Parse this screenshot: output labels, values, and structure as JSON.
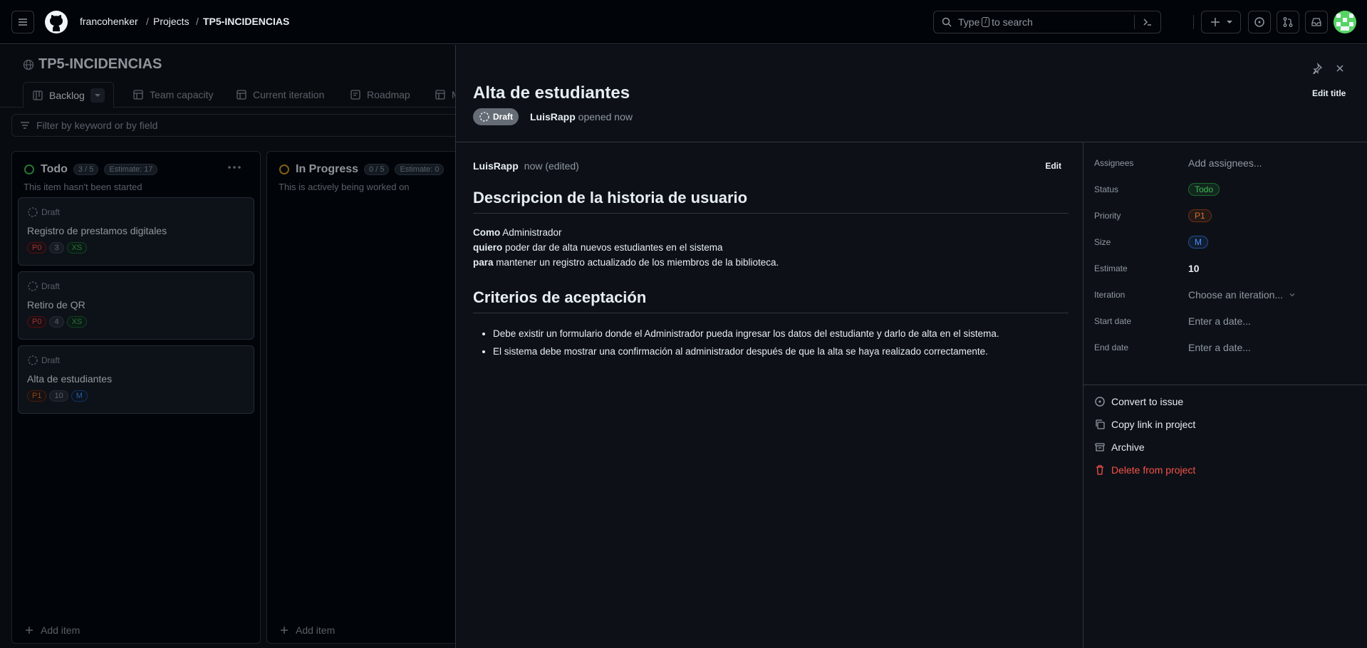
{
  "header": {
    "owner": "francohenker",
    "projects": "Projects",
    "project": "TP5-INCIDENCIAS",
    "search_pre": "Type",
    "search_key": "/",
    "search_post": "to search"
  },
  "board": {
    "title": "TP5-INCIDENCIAS",
    "tabs": [
      "Backlog",
      "Team capacity",
      "Current iteration",
      "Roadmap",
      "M"
    ],
    "filter_placeholder": "Filter by keyword or by field",
    "columns": [
      {
        "name": "Todo",
        "count": "3 / 5",
        "estimate": "Estimate: 17",
        "desc": "This item hasn't been started",
        "add": "Add item"
      },
      {
        "name": "In Progress",
        "count": "0 / 5",
        "estimate": "Estimate: 0",
        "desc": "This is actively being worked on",
        "add": "Add item"
      }
    ],
    "cards": [
      {
        "draft": "Draft",
        "title": "Registro de prestamos digitales",
        "tags": [
          "P0",
          "3",
          "XS"
        ]
      },
      {
        "draft": "Draft",
        "title": "Retiro de QR",
        "tags": [
          "P0",
          "4",
          "XS"
        ]
      },
      {
        "draft": "Draft",
        "title": "Alta de estudiantes",
        "tags": [
          "P1",
          "10",
          "M"
        ]
      }
    ]
  },
  "detail": {
    "title": "Alta de estudiantes",
    "edit_title": "Edit title",
    "badge": "Draft",
    "author": "LuisRapp",
    "opened": "opened now",
    "comment_time": "now (edited)",
    "edit": "Edit",
    "heading1": "Descripcion de la historia de usuario",
    "line1_bold": "Como",
    "line1_rest": " Administrador",
    "line2_bold": "quiero",
    "line2_rest": " poder dar de alta nuevos estudiantes en el sistema",
    "line3_bold": "para",
    "line3_rest": " mantener un registro actualizado de los miembros de la biblioteca.",
    "heading2": "Criterios de aceptación",
    "criteria": [
      "Debe existir un formulario donde el Administrador pueda ingresar los datos del estudiante y darlo de alta en el sistema.",
      "El sistema debe mostrar una confirmación al administrador después de que la alta se haya realizado correctamente."
    ]
  },
  "fields": {
    "assignees_label": "Assignees",
    "assignees_value": "Add assignees...",
    "status_label": "Status",
    "status_value": "Todo",
    "priority_label": "Priority",
    "priority_value": "P1",
    "size_label": "Size",
    "size_value": "M",
    "estimate_label": "Estimate",
    "estimate_value": "10",
    "iteration_label": "Iteration",
    "iteration_value": "Choose an iteration...",
    "start_label": "Start date",
    "start_value": "Enter a date...",
    "end_label": "End date",
    "end_value": "Enter a date..."
  },
  "actions": {
    "convert": "Convert to issue",
    "copy": "Copy link in project",
    "archive": "Archive",
    "delete": "Delete from project"
  },
  "colors": {
    "green": "#3fb950",
    "orange": "#db6d28",
    "red": "#f85149",
    "blue": "#4493f8",
    "yellow": "#d29922"
  }
}
